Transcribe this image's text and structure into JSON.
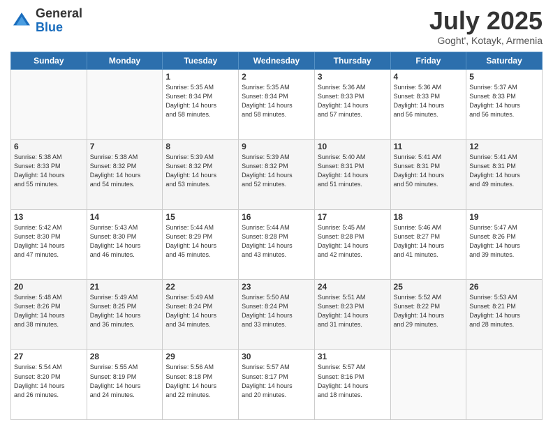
{
  "header": {
    "logo_general": "General",
    "logo_blue": "Blue",
    "month_year": "July 2025",
    "location": "Goght', Kotayk, Armenia"
  },
  "days_of_week": [
    "Sunday",
    "Monday",
    "Tuesday",
    "Wednesday",
    "Thursday",
    "Friday",
    "Saturday"
  ],
  "weeks": [
    [
      {
        "day": "",
        "info": ""
      },
      {
        "day": "",
        "info": ""
      },
      {
        "day": "1",
        "info": "Sunrise: 5:35 AM\nSunset: 8:34 PM\nDaylight: 14 hours\nand 58 minutes."
      },
      {
        "day": "2",
        "info": "Sunrise: 5:35 AM\nSunset: 8:34 PM\nDaylight: 14 hours\nand 58 minutes."
      },
      {
        "day": "3",
        "info": "Sunrise: 5:36 AM\nSunset: 8:33 PM\nDaylight: 14 hours\nand 57 minutes."
      },
      {
        "day": "4",
        "info": "Sunrise: 5:36 AM\nSunset: 8:33 PM\nDaylight: 14 hours\nand 56 minutes."
      },
      {
        "day": "5",
        "info": "Sunrise: 5:37 AM\nSunset: 8:33 PM\nDaylight: 14 hours\nand 56 minutes."
      }
    ],
    [
      {
        "day": "6",
        "info": "Sunrise: 5:38 AM\nSunset: 8:33 PM\nDaylight: 14 hours\nand 55 minutes."
      },
      {
        "day": "7",
        "info": "Sunrise: 5:38 AM\nSunset: 8:32 PM\nDaylight: 14 hours\nand 54 minutes."
      },
      {
        "day": "8",
        "info": "Sunrise: 5:39 AM\nSunset: 8:32 PM\nDaylight: 14 hours\nand 53 minutes."
      },
      {
        "day": "9",
        "info": "Sunrise: 5:39 AM\nSunset: 8:32 PM\nDaylight: 14 hours\nand 52 minutes."
      },
      {
        "day": "10",
        "info": "Sunrise: 5:40 AM\nSunset: 8:31 PM\nDaylight: 14 hours\nand 51 minutes."
      },
      {
        "day": "11",
        "info": "Sunrise: 5:41 AM\nSunset: 8:31 PM\nDaylight: 14 hours\nand 50 minutes."
      },
      {
        "day": "12",
        "info": "Sunrise: 5:41 AM\nSunset: 8:31 PM\nDaylight: 14 hours\nand 49 minutes."
      }
    ],
    [
      {
        "day": "13",
        "info": "Sunrise: 5:42 AM\nSunset: 8:30 PM\nDaylight: 14 hours\nand 47 minutes."
      },
      {
        "day": "14",
        "info": "Sunrise: 5:43 AM\nSunset: 8:30 PM\nDaylight: 14 hours\nand 46 minutes."
      },
      {
        "day": "15",
        "info": "Sunrise: 5:44 AM\nSunset: 8:29 PM\nDaylight: 14 hours\nand 45 minutes."
      },
      {
        "day": "16",
        "info": "Sunrise: 5:44 AM\nSunset: 8:28 PM\nDaylight: 14 hours\nand 43 minutes."
      },
      {
        "day": "17",
        "info": "Sunrise: 5:45 AM\nSunset: 8:28 PM\nDaylight: 14 hours\nand 42 minutes."
      },
      {
        "day": "18",
        "info": "Sunrise: 5:46 AM\nSunset: 8:27 PM\nDaylight: 14 hours\nand 41 minutes."
      },
      {
        "day": "19",
        "info": "Sunrise: 5:47 AM\nSunset: 8:26 PM\nDaylight: 14 hours\nand 39 minutes."
      }
    ],
    [
      {
        "day": "20",
        "info": "Sunrise: 5:48 AM\nSunset: 8:26 PM\nDaylight: 14 hours\nand 38 minutes."
      },
      {
        "day": "21",
        "info": "Sunrise: 5:49 AM\nSunset: 8:25 PM\nDaylight: 14 hours\nand 36 minutes."
      },
      {
        "day": "22",
        "info": "Sunrise: 5:49 AM\nSunset: 8:24 PM\nDaylight: 14 hours\nand 34 minutes."
      },
      {
        "day": "23",
        "info": "Sunrise: 5:50 AM\nSunset: 8:24 PM\nDaylight: 14 hours\nand 33 minutes."
      },
      {
        "day": "24",
        "info": "Sunrise: 5:51 AM\nSunset: 8:23 PM\nDaylight: 14 hours\nand 31 minutes."
      },
      {
        "day": "25",
        "info": "Sunrise: 5:52 AM\nSunset: 8:22 PM\nDaylight: 14 hours\nand 29 minutes."
      },
      {
        "day": "26",
        "info": "Sunrise: 5:53 AM\nSunset: 8:21 PM\nDaylight: 14 hours\nand 28 minutes."
      }
    ],
    [
      {
        "day": "27",
        "info": "Sunrise: 5:54 AM\nSunset: 8:20 PM\nDaylight: 14 hours\nand 26 minutes."
      },
      {
        "day": "28",
        "info": "Sunrise: 5:55 AM\nSunset: 8:19 PM\nDaylight: 14 hours\nand 24 minutes."
      },
      {
        "day": "29",
        "info": "Sunrise: 5:56 AM\nSunset: 8:18 PM\nDaylight: 14 hours\nand 22 minutes."
      },
      {
        "day": "30",
        "info": "Sunrise: 5:57 AM\nSunset: 8:17 PM\nDaylight: 14 hours\nand 20 minutes."
      },
      {
        "day": "31",
        "info": "Sunrise: 5:57 AM\nSunset: 8:16 PM\nDaylight: 14 hours\nand 18 minutes."
      },
      {
        "day": "",
        "info": ""
      },
      {
        "day": "",
        "info": ""
      }
    ]
  ]
}
